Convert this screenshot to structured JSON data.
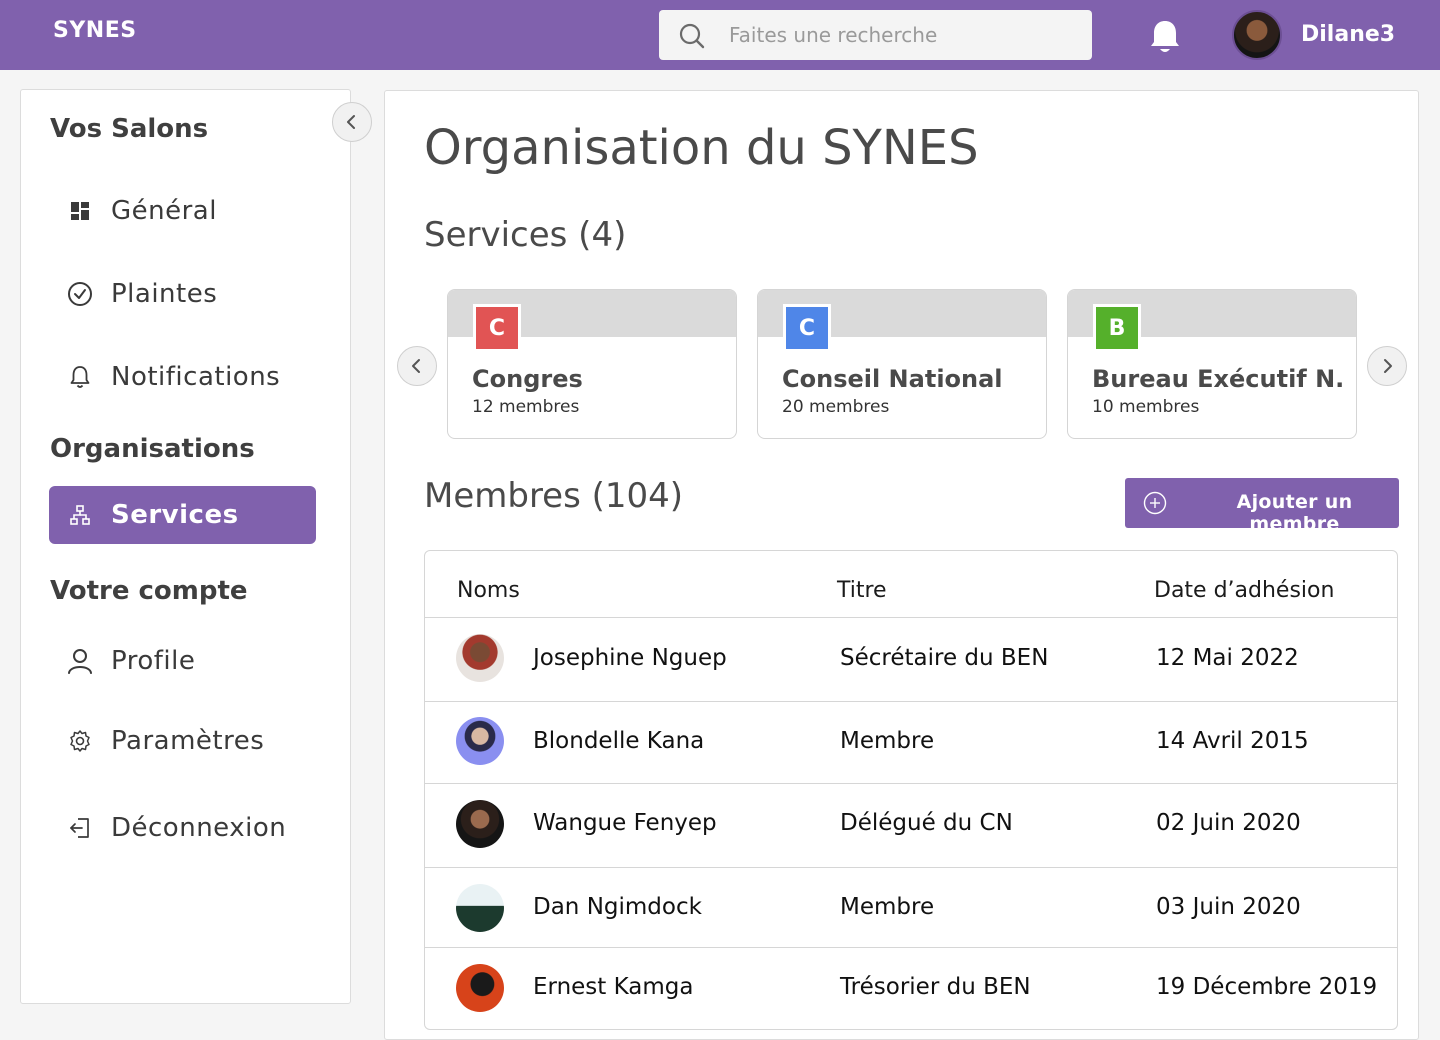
{
  "header": {
    "brand": "SYNES",
    "search_placeholder": "Faites une recherche",
    "username": "Dilane3"
  },
  "sidebar": {
    "sections": [
      {
        "title": "Vos Salons"
      },
      {
        "title": "Organisations"
      },
      {
        "title": "Votre compte"
      }
    ],
    "items": [
      {
        "label": "Général",
        "icon": "dashboard-icon"
      },
      {
        "label": "Plaintes",
        "icon": "check-circle-icon"
      },
      {
        "label": "Notifications",
        "icon": "bell-icon"
      },
      {
        "label": "Services",
        "icon": "hierarchy-icon",
        "active": true
      },
      {
        "label": "Profile",
        "icon": "user-icon"
      },
      {
        "label": "Paramètres",
        "icon": "gear-icon"
      },
      {
        "label": "Déconnexion",
        "icon": "logout-icon"
      }
    ]
  },
  "main": {
    "title": "Organisation du SYNES",
    "services_heading": "Services (4)",
    "members_heading": "Membres (104)",
    "add_member_label": "Ajouter un membre",
    "services": [
      {
        "badge": "C",
        "name": "Congres",
        "members": "12 membres",
        "color": "#e15454"
      },
      {
        "badge": "C",
        "name": "Conseil National",
        "members": "20 membres",
        "color": "#4f86e8"
      },
      {
        "badge": "B",
        "name": "Bureau Exécutif N.",
        "members": "10 membres",
        "color": "#55b02b"
      }
    ],
    "table": {
      "columns": [
        "Noms",
        "Titre",
        "Date d’adhésion"
      ],
      "rows": [
        {
          "name": "Josephine Nguep",
          "title": "Sécrétaire du BEN",
          "date": "12 Mai 2022"
        },
        {
          "name": "Blondelle Kana",
          "title": "Membre",
          "date": "14 Avril 2015"
        },
        {
          "name": "Wangue Fenyep",
          "title": "Délégué du CN",
          "date": "02 Juin 2020"
        },
        {
          "name": "Dan Ngimdock",
          "title": "Membre",
          "date": "03 Juin 2020"
        },
        {
          "name": "Ernest Kamga",
          "title": "Trésorier du BEN",
          "date": "19 Décembre 2019"
        }
      ]
    }
  },
  "colors": {
    "accent": "#8061ad",
    "text": "#1b1b1b"
  }
}
